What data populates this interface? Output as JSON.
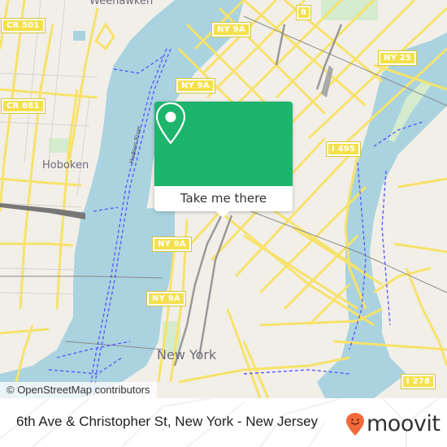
{
  "map": {
    "attribution": "© OpenStreetMap contributors",
    "place_labels": {
      "weehawken": "Weehawken",
      "hoboken": "Hoboken",
      "new_york": "New York"
    },
    "river_label": "Hudson River",
    "shields": {
      "cr501": "CR 501",
      "cr681": "CR 681",
      "route8": "8",
      "ny9a_1": "NY 9A",
      "ny9a_2": "NY 9A",
      "ny9a_3": "NY 9A",
      "ny9a_4": "NY 9A",
      "ny25": "NY 25",
      "i495": "I 495",
      "i278": "I 278"
    },
    "colors": {
      "water": "#aad3df",
      "land": "#f2efe9",
      "road": "#f7e26b",
      "ferry": "#5a5aff"
    }
  },
  "popup": {
    "icon": "map-pin-icon",
    "button_label": "Take me there",
    "accent_color": "#1db46c"
  },
  "footer": {
    "address": "6th Ave & Christopher St, New York - New Jersey",
    "brand": "moovit",
    "brand_icon": "moovit-smiley-pin-icon",
    "brand_color": "#f26a3b"
  }
}
